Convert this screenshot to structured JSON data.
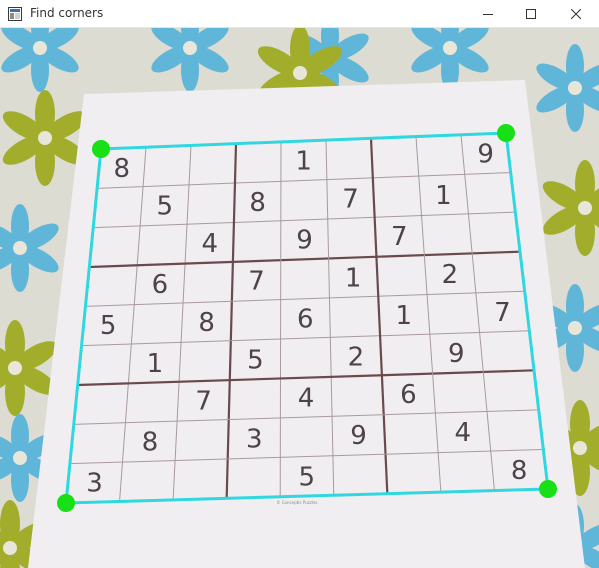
{
  "window": {
    "title": "Find corners",
    "controls": [
      "minimize",
      "maximize",
      "close"
    ]
  },
  "colors": {
    "outline": "#2fd8e0",
    "corner": "#17e017",
    "grid_thick": "#6a4a4e",
    "grid_thin": "#a89a9c",
    "digit": "#4e4448",
    "paper": "#f1eff1"
  },
  "sudoku": {
    "rows": [
      [
        "8",
        "",
        "",
        "",
        "1",
        "",
        "",
        "",
        "9"
      ],
      [
        "",
        "5",
        "",
        "8",
        "",
        "7",
        "",
        "1",
        ""
      ],
      [
        "",
        "",
        "4",
        "",
        "9",
        "",
        "7",
        "",
        ""
      ],
      [
        "",
        "6",
        "",
        "7",
        "",
        "1",
        "",
        "2",
        ""
      ],
      [
        "5",
        "",
        "8",
        "",
        "6",
        "",
        "1",
        "",
        "7"
      ],
      [
        "",
        "1",
        "",
        "5",
        "",
        "2",
        "",
        "9",
        ""
      ],
      [
        "",
        "",
        "7",
        "",
        "4",
        "",
        "6",
        "",
        ""
      ],
      [
        "",
        "8",
        "",
        "3",
        "",
        "9",
        "",
        "4",
        ""
      ],
      [
        "3",
        "",
        "",
        "",
        "5",
        "",
        "",
        "",
        "8"
      ]
    ]
  },
  "corners": [
    "top-left",
    "top-right",
    "bottom-right",
    "bottom-left"
  ],
  "footer_text": "© Conceptis Puzzles"
}
